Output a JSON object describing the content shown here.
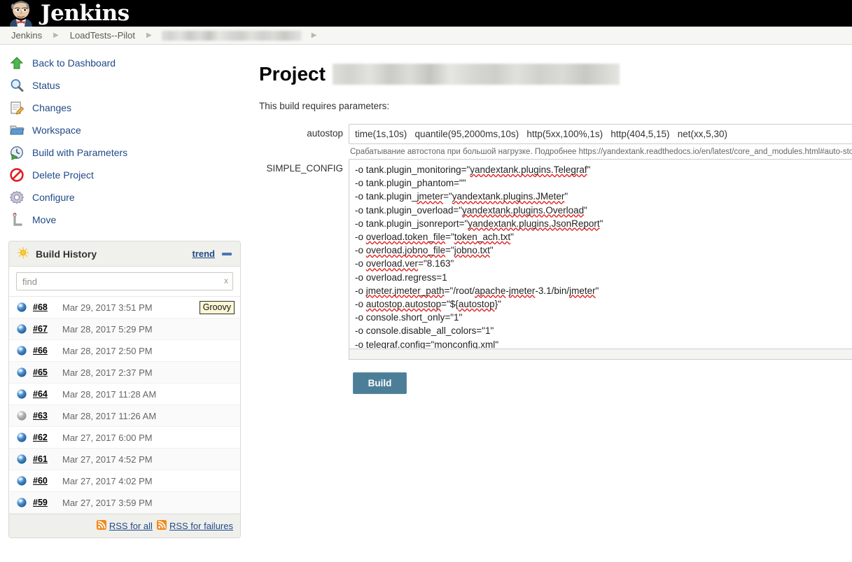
{
  "header": {
    "brand": "Jenkins",
    "logo_icon": "jenkins-butler-icon"
  },
  "breadcrumbs": [
    {
      "label": "Jenkins",
      "redacted": false
    },
    {
      "label": "LoadTests--Pilot",
      "redacted": false
    },
    {
      "label": "",
      "redacted": true
    }
  ],
  "sidebar": {
    "tasks": [
      {
        "label": "Back to Dashboard",
        "icon": "up-arrow-icon"
      },
      {
        "label": "Status",
        "icon": "magnifier-icon"
      },
      {
        "label": "Changes",
        "icon": "notepad-pencil-icon"
      },
      {
        "label": "Workspace",
        "icon": "folder-icon"
      },
      {
        "label": "Build with Parameters",
        "icon": "clock-play-icon"
      },
      {
        "label": "Delete Project",
        "icon": "no-entry-icon"
      },
      {
        "label": "Configure",
        "icon": "gear-icon"
      },
      {
        "label": "Move",
        "icon": "move-icon"
      }
    ],
    "build_history": {
      "title": "Build History",
      "title_icon": "sun-icon",
      "trend_label": "trend",
      "collapse_icon": "minus-icon",
      "find_placeholder": "find",
      "find_value": "",
      "find_clear_label": "x",
      "builds": [
        {
          "number": "#68",
          "date": "Mar 29, 2017 3:51 PM",
          "status": "blue",
          "badge": "Groovy"
        },
        {
          "number": "#67",
          "date": "Mar 28, 2017 5:29 PM",
          "status": "blue",
          "badge": ""
        },
        {
          "number": "#66",
          "date": "Mar 28, 2017 2:50 PM",
          "status": "blue",
          "badge": ""
        },
        {
          "number": "#65",
          "date": "Mar 28, 2017 2:37 PM",
          "status": "blue",
          "badge": ""
        },
        {
          "number": "#64",
          "date": "Mar 28, 2017 11:28 AM",
          "status": "blue",
          "badge": ""
        },
        {
          "number": "#63",
          "date": "Mar 28, 2017 11:26 AM",
          "status": "grey",
          "badge": ""
        },
        {
          "number": "#62",
          "date": "Mar 27, 2017 6:00 PM",
          "status": "blue",
          "badge": ""
        },
        {
          "number": "#61",
          "date": "Mar 27, 2017 4:52 PM",
          "status": "blue",
          "badge": ""
        },
        {
          "number": "#60",
          "date": "Mar 27, 2017 4:02 PM",
          "status": "blue",
          "badge": ""
        },
        {
          "number": "#59",
          "date": "Mar 27, 2017 3:59 PM",
          "status": "blue",
          "badge": ""
        }
      ],
      "rss_all": "RSS for all",
      "rss_failures": "RSS for failures",
      "rss_icon": "rss-feed-icon"
    }
  },
  "main": {
    "title_prefix": "Project",
    "title_redacted": true,
    "requires_params": "This build requires parameters:",
    "params": [
      {
        "name": "autostop",
        "type": "text",
        "value": "time(1s,10s)   quantile(95,2000ms,10s)   http(5xx,100%,1s)   http(404,5,15)   net(xx,5,30)",
        "description": "Срабатывание автостопа при большой нагрузке. Подробнее https://yandextank.readthedocs.io/en/latest/core_and_modules.html#auto-stop"
      },
      {
        "name": "SIMPLE_CONFIG",
        "type": "textarea",
        "value": "-o tank.plugin_monitoring=\"yandextank.plugins.Telegraf\"\n-o tank.plugin_phantom=\"\"\n-o tank.plugin_jmeter=\"yandextank.plugins.JMeter\"\n-o tank.plugin_overload=\"yandextank.plugins.Overload\"\n-o tank.plugin_jsonreport=\"yandextank.plugins.JsonReport\"\n-o overload.token_file=\"token_ach.txt\"\n-o overload.jobno_file=\"jobno.txt\"\n-o overload.ver=\"8.163\"\n-o overload.regress=1\n-o jmeter.jmeter_path=\"/root/apache-jmeter-3.1/bin/jmeter\"\n-o autostop.autostop=\"${autostop}\"\n-o console.short_only=\"1\"\n-o console.disable_all_colors=\"1\"\n-o telegraf.config=\"monconfig.xml\""
      }
    ],
    "build_button": "Build"
  },
  "colors": {
    "topbar_bg": "#000000",
    "breadcrumb_bg": "#f6f6f3",
    "link": "#204a87",
    "build_button_bg": "#4c7e98",
    "badge_bg": "#fbf7d4",
    "ball_blue": "#4a8fd0",
    "ball_grey": "#b4b4b4",
    "rss_orange": "#f2891a"
  }
}
